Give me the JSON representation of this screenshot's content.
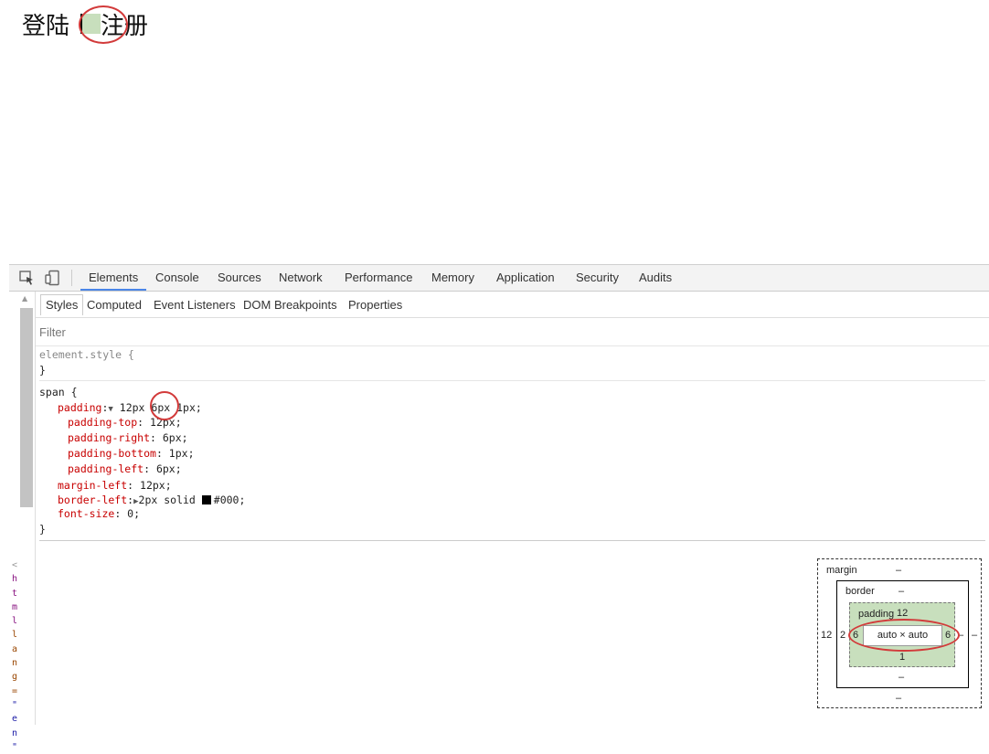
{
  "page": {
    "text_before": "登陆",
    "text_after": "注册"
  },
  "devtools": {
    "toolbar_icons": [
      "inspect-element-icon",
      "device-toolbar-icon"
    ],
    "tabs": [
      "Elements",
      "Console",
      "Sources",
      "Network",
      "Performance",
      "Memory",
      "Application",
      "Security",
      "Audits"
    ],
    "active_tab": "Elements",
    "sidebar_tabs": [
      "Styles",
      "Computed",
      "Event Listeners",
      "DOM Breakpoints",
      "Properties"
    ],
    "active_sidebar_tab": "Styles",
    "filter_placeholder": "Filter",
    "vertical_source": [
      "<",
      "h",
      "t",
      "m",
      "l",
      " ",
      "l",
      "a",
      "n",
      "g",
      "=",
      "\"",
      "e",
      "n",
      "\""
    ],
    "element_style": {
      "selector": "element.style {",
      "close": "}"
    },
    "span_rule": {
      "selector": "span {",
      "padding_name": "padding",
      "padding_v1": "12px",
      "padding_v2": "6px",
      "padding_v3": "1px;",
      "longhands": [
        {
          "name": "padding-top",
          "value": "12px;"
        },
        {
          "name": "padding-right",
          "value": "6px;"
        },
        {
          "name": "padding-bottom",
          "value": "1px;"
        },
        {
          "name": "padding-left",
          "value": "6px;"
        }
      ],
      "margin_left_name": "margin-left",
      "margin_left_value": "12px;",
      "border_left_name": "border-left",
      "border_left_value_pre": "2px solid",
      "border_left_color": "#000;",
      "font_size_name": "font-size",
      "font_size_value": "0;",
      "close": "}"
    },
    "box_model": {
      "margin_label": "margin",
      "margin_top": "–",
      "margin_bottom": "–",
      "margin_left": "12",
      "margin_right": "–",
      "border_label": "border",
      "border_top": "–",
      "border_bottom": "–",
      "border_left": "2",
      "border_right": "–",
      "padding_label": "padding",
      "padding_top": "12",
      "padding_bottom": "1",
      "padding_left": "6",
      "padding_right": "6",
      "content": "auto × auto"
    }
  },
  "colors": {
    "highlight_green": "#c8dfbd",
    "annotation_red": "#d23a3a",
    "css_property": "#c80000",
    "active_tab_underline": "#4a86e8"
  }
}
